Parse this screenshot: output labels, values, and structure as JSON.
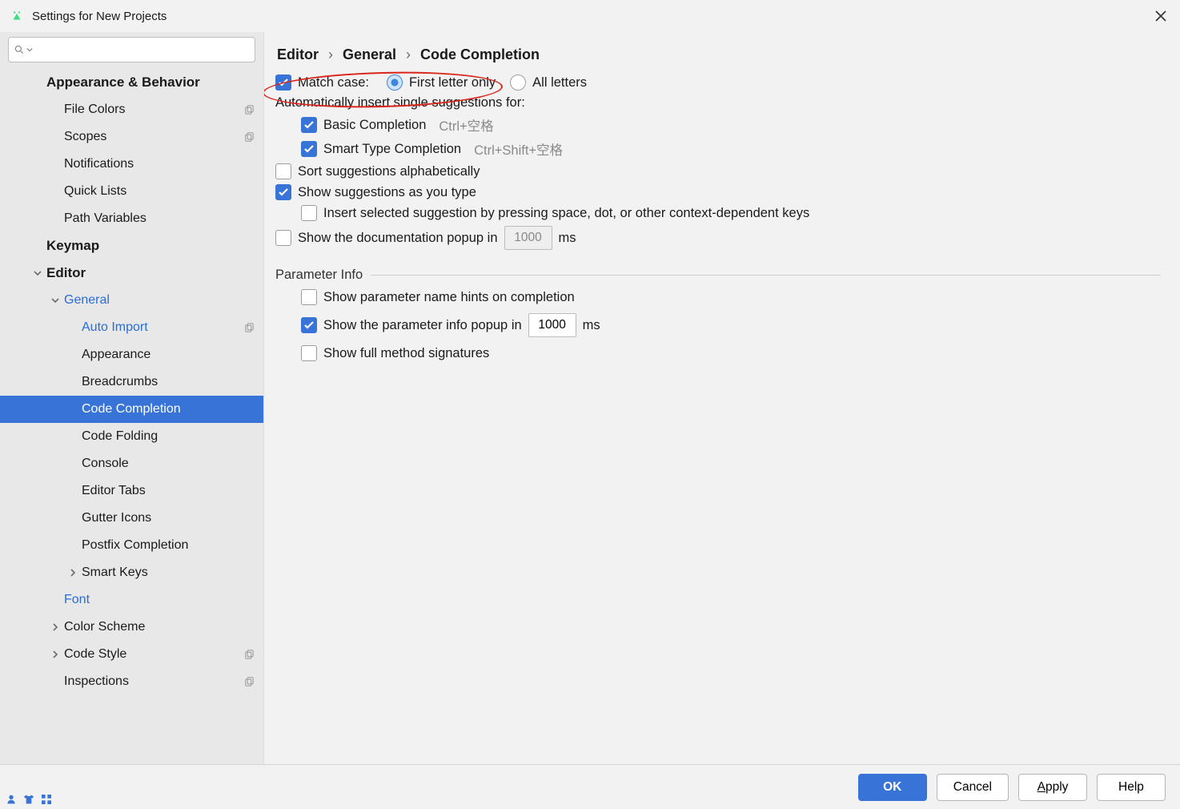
{
  "title": "Settings for New Projects",
  "breadcrumb": [
    "Editor",
    "General",
    "Code Completion"
  ],
  "sidebar": {
    "items": [
      {
        "label": "Appearance & Behavior",
        "indent": 1,
        "bold": true
      },
      {
        "label": "File Colors",
        "indent": 2,
        "copy": true
      },
      {
        "label": "Scopes",
        "indent": 2,
        "copy": true
      },
      {
        "label": "Notifications",
        "indent": 2
      },
      {
        "label": "Quick Lists",
        "indent": 2
      },
      {
        "label": "Path Variables",
        "indent": 2
      },
      {
        "label": "Keymap",
        "indent": 1,
        "bold": true
      },
      {
        "label": "Editor",
        "indent": 1,
        "bold": true,
        "expand": "open"
      },
      {
        "label": "General",
        "indent": 2,
        "link": true,
        "expand": "open"
      },
      {
        "label": "Auto Import",
        "indent": 3,
        "link": true,
        "copy": true
      },
      {
        "label": "Appearance",
        "indent": 3
      },
      {
        "label": "Breadcrumbs",
        "indent": 3
      },
      {
        "label": "Code Completion",
        "indent": 3,
        "selected": true
      },
      {
        "label": "Code Folding",
        "indent": 3
      },
      {
        "label": "Console",
        "indent": 3
      },
      {
        "label": "Editor Tabs",
        "indent": 3
      },
      {
        "label": "Gutter Icons",
        "indent": 3
      },
      {
        "label": "Postfix Completion",
        "indent": 3
      },
      {
        "label": "Smart Keys",
        "indent": 3,
        "expand": "closed"
      },
      {
        "label": "Font",
        "indent": 2,
        "link": true
      },
      {
        "label": "Color Scheme",
        "indent": 2,
        "expand": "closed"
      },
      {
        "label": "Code Style",
        "indent": 2,
        "expand": "closed",
        "copy": true
      },
      {
        "label": "Inspections",
        "indent": 2,
        "copy": true
      }
    ]
  },
  "content": {
    "match_case": {
      "label": "Match case:",
      "checked": true
    },
    "match_radio": {
      "first": {
        "label": "First letter only",
        "on": true
      },
      "all": {
        "label": "All letters",
        "on": false
      }
    },
    "auto_insert_header": "Automatically insert single suggestions for:",
    "basic": {
      "label": "Basic Completion",
      "hint": "Ctrl+空格",
      "checked": true
    },
    "smart": {
      "label": "Smart Type Completion",
      "hint": "Ctrl+Shift+空格",
      "checked": true
    },
    "sort_alpha": {
      "label": "Sort suggestions alphabetically",
      "checked": false
    },
    "show_as_type": {
      "label": "Show suggestions as you type",
      "checked": true
    },
    "insert_space": {
      "label": "Insert selected suggestion by pressing space, dot, or other context-dependent keys",
      "checked": false
    },
    "doc_popup": {
      "label_pre": "Show the documentation popup in",
      "value": "1000",
      "unit": "ms",
      "checked": false
    },
    "section_param": "Parameter Info",
    "param_hints": {
      "label": "Show parameter name hints on completion",
      "checked": false
    },
    "param_popup": {
      "label_pre": "Show the parameter info popup in",
      "value": "1000",
      "unit": "ms",
      "checked": true
    },
    "full_sig": {
      "label": "Show full method signatures",
      "checked": false
    }
  },
  "buttons": {
    "ok": "OK",
    "cancel": "Cancel",
    "apply": "Apply",
    "help": "Help"
  }
}
